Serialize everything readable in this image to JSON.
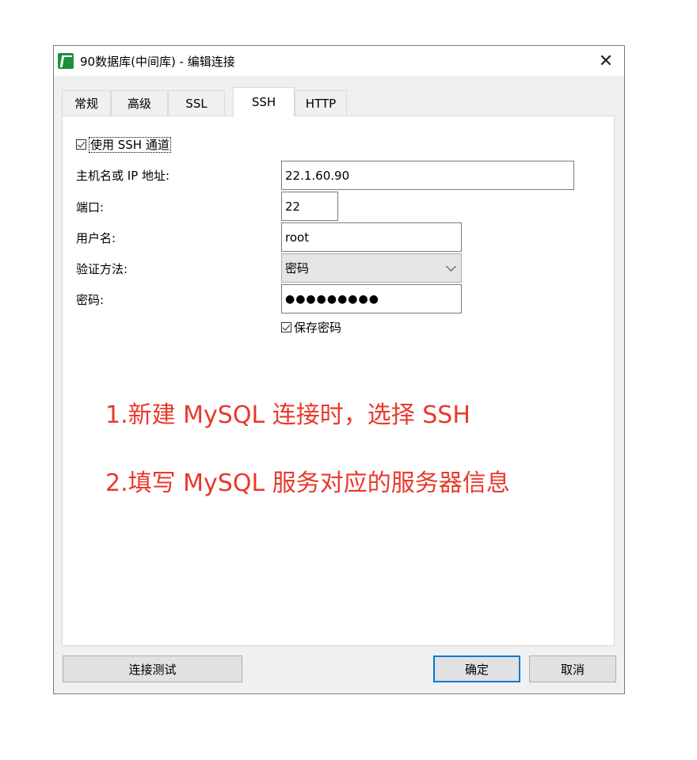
{
  "window": {
    "title": "90数据库(中间库) - 编辑连接",
    "close_glyph": "✕"
  },
  "tabs": [
    {
      "label": "常规",
      "active": false
    },
    {
      "label": "高级",
      "active": false
    },
    {
      "label": "SSL",
      "active": false
    },
    {
      "label": "SSH",
      "active": true
    },
    {
      "label": "HTTP",
      "active": false
    }
  ],
  "ssh": {
    "use_ssh_label": "使用 SSH 通道",
    "use_ssh_checked": true,
    "host_label": "主机名或 IP 地址:",
    "host_value": "22.1.60.90",
    "port_label": "端口:",
    "port_value": "22",
    "user_label": "用户名:",
    "user_value": "root",
    "auth_label": "验证方法:",
    "auth_value": "密码",
    "password_label": "密码:",
    "password_value": "●●●●●●●●●",
    "save_password_label": "保存密码",
    "save_password_checked": true
  },
  "annotations": {
    "line1": "1.新建 MySQL 连接时，选择 SSH",
    "line2": "2.填写 MySQL 服务对应的服务器信息",
    "color": "#e8392c"
  },
  "buttons": {
    "test": "连接测试",
    "ok": "确定",
    "cancel": "取消"
  },
  "icons": {
    "app": "navicat-app-icon",
    "close": "close-icon",
    "dropdown": "chevron-down-icon",
    "checkbox": "checkbox-checked-icon"
  }
}
